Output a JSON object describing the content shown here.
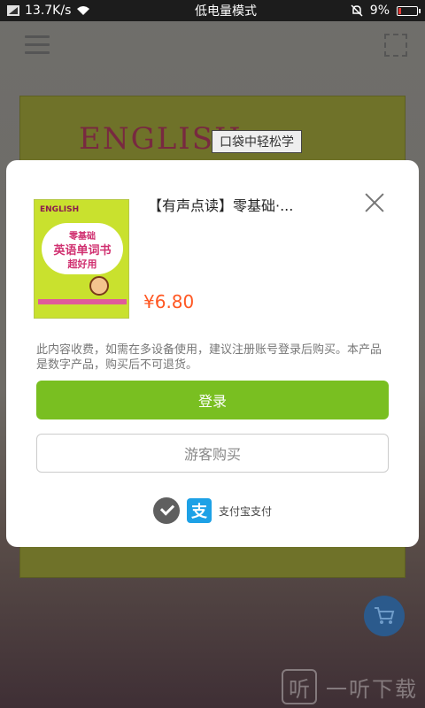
{
  "status_bar": {
    "speed": "13.7K/s",
    "mode": "低电量模式",
    "battery": "9%",
    "battery_level": 0.09
  },
  "background": {
    "cover_title": "ENGLISH",
    "cover_tag": "口袋中轻松学"
  },
  "dialog": {
    "book_title": "【有声点读】零基础·...",
    "price": "¥6.80",
    "thumb": {
      "top": "ENGLISH",
      "line1": "零基础",
      "line2": "英语单词书",
      "line3": "超好用"
    },
    "notice": "此内容收费，如需在多设备使用，建议注册账号登录后购买。本产品是数字产品，购买后不可退货。",
    "login_label": "登录",
    "guest_label": "游客购买",
    "alipay_glyph": "支",
    "pay_label": "支付宝支付"
  },
  "watermark": {
    "logo": "听",
    "text": "一听下载"
  },
  "colors": {
    "login": "#79bf21",
    "price": "#ff5722",
    "alipay": "#1da1e6"
  }
}
